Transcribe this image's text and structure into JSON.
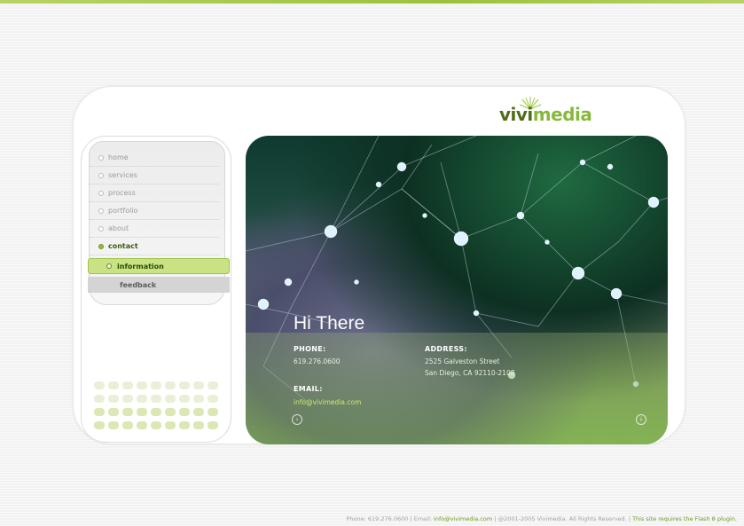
{
  "brand": {
    "logo_part1": "vivi",
    "logo_part2": "media"
  },
  "nav": {
    "items": [
      {
        "label": "home",
        "active": false
      },
      {
        "label": "services",
        "active": false
      },
      {
        "label": "process",
        "active": false
      },
      {
        "label": "portfolio",
        "active": false
      },
      {
        "label": "about",
        "active": false
      },
      {
        "label": "contact",
        "active": true
      }
    ],
    "sub_items": [
      {
        "label": "information",
        "selected": true
      },
      {
        "label": "feedback",
        "selected": false
      }
    ]
  },
  "hero": {
    "title": "Hi There",
    "phone_label": "PHONE:",
    "phone_value": "619.276.0600",
    "address_label": "ADDRESS:",
    "address_line1": "2525 Galveston Street",
    "address_line2": "San Diego, CA 92110-2108",
    "email_label": "EMAIL:",
    "email_value": "info@vivimedia.com"
  },
  "footer": {
    "phone": "Phone: 619.276.0600",
    "email_prefix": "Email:",
    "email": "info@vivimedia.com",
    "copyright": "@2001-2005 Vivimedia. All Rights Reserved.",
    "flash_note": "This site requires the Flash 8 plugin."
  },
  "colors": {
    "accent": "#8bbf3a",
    "brand_dark": "#4f6c19",
    "brand_light": "#86b83b"
  }
}
